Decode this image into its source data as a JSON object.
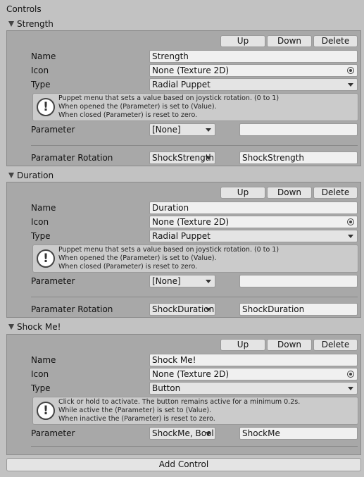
{
  "header": {
    "title": "Controls"
  },
  "buttons": {
    "up": "Up",
    "down": "Down",
    "delete": "Delete",
    "add_control": "Add Control"
  },
  "labels": {
    "name": "Name",
    "icon": "Icon",
    "type": "Type",
    "parameter": "Parameter",
    "parameter_rotation": "Paramater Rotation"
  },
  "controls": [
    {
      "title": "Strength",
      "name": "Strength",
      "icon": "None (Texture 2D)",
      "type": "Radial Puppet",
      "info": [
        "Puppet menu that sets a value based on joystick rotation. (0 to 1)",
        "When opened the (Parameter) is set to (Value).",
        "When closed (Parameter) is reset to zero."
      ],
      "parameter": "[None]",
      "parameter_value": "",
      "rotation_dropdown": "ShockStrength",
      "rotation_value": "ShockStrength"
    },
    {
      "title": "Duration",
      "name": "Duration",
      "icon": "None (Texture 2D)",
      "type": "Radial Puppet",
      "info": [
        "Puppet menu that sets a value based on joystick rotation. (0 to 1)",
        "When opened the (Parameter) is set to (Value).",
        "When closed (Parameter) is reset to zero."
      ],
      "parameter": "[None]",
      "parameter_value": "",
      "rotation_dropdown": "ShockDuration",
      "rotation_value": "ShockDuration"
    },
    {
      "title": "Shock Me!",
      "name": "Shock Me!",
      "icon": "None (Texture 2D)",
      "type": "Button",
      "info": [
        "Click or hold to activate. The button remains active for a minimum 0.2s.",
        "While active the (Parameter) is set to (Value).",
        "When inactive the (Parameter) is reset to zero."
      ],
      "parameter": "ShockMe, Bool",
      "parameter_value": "ShockMe"
    }
  ]
}
